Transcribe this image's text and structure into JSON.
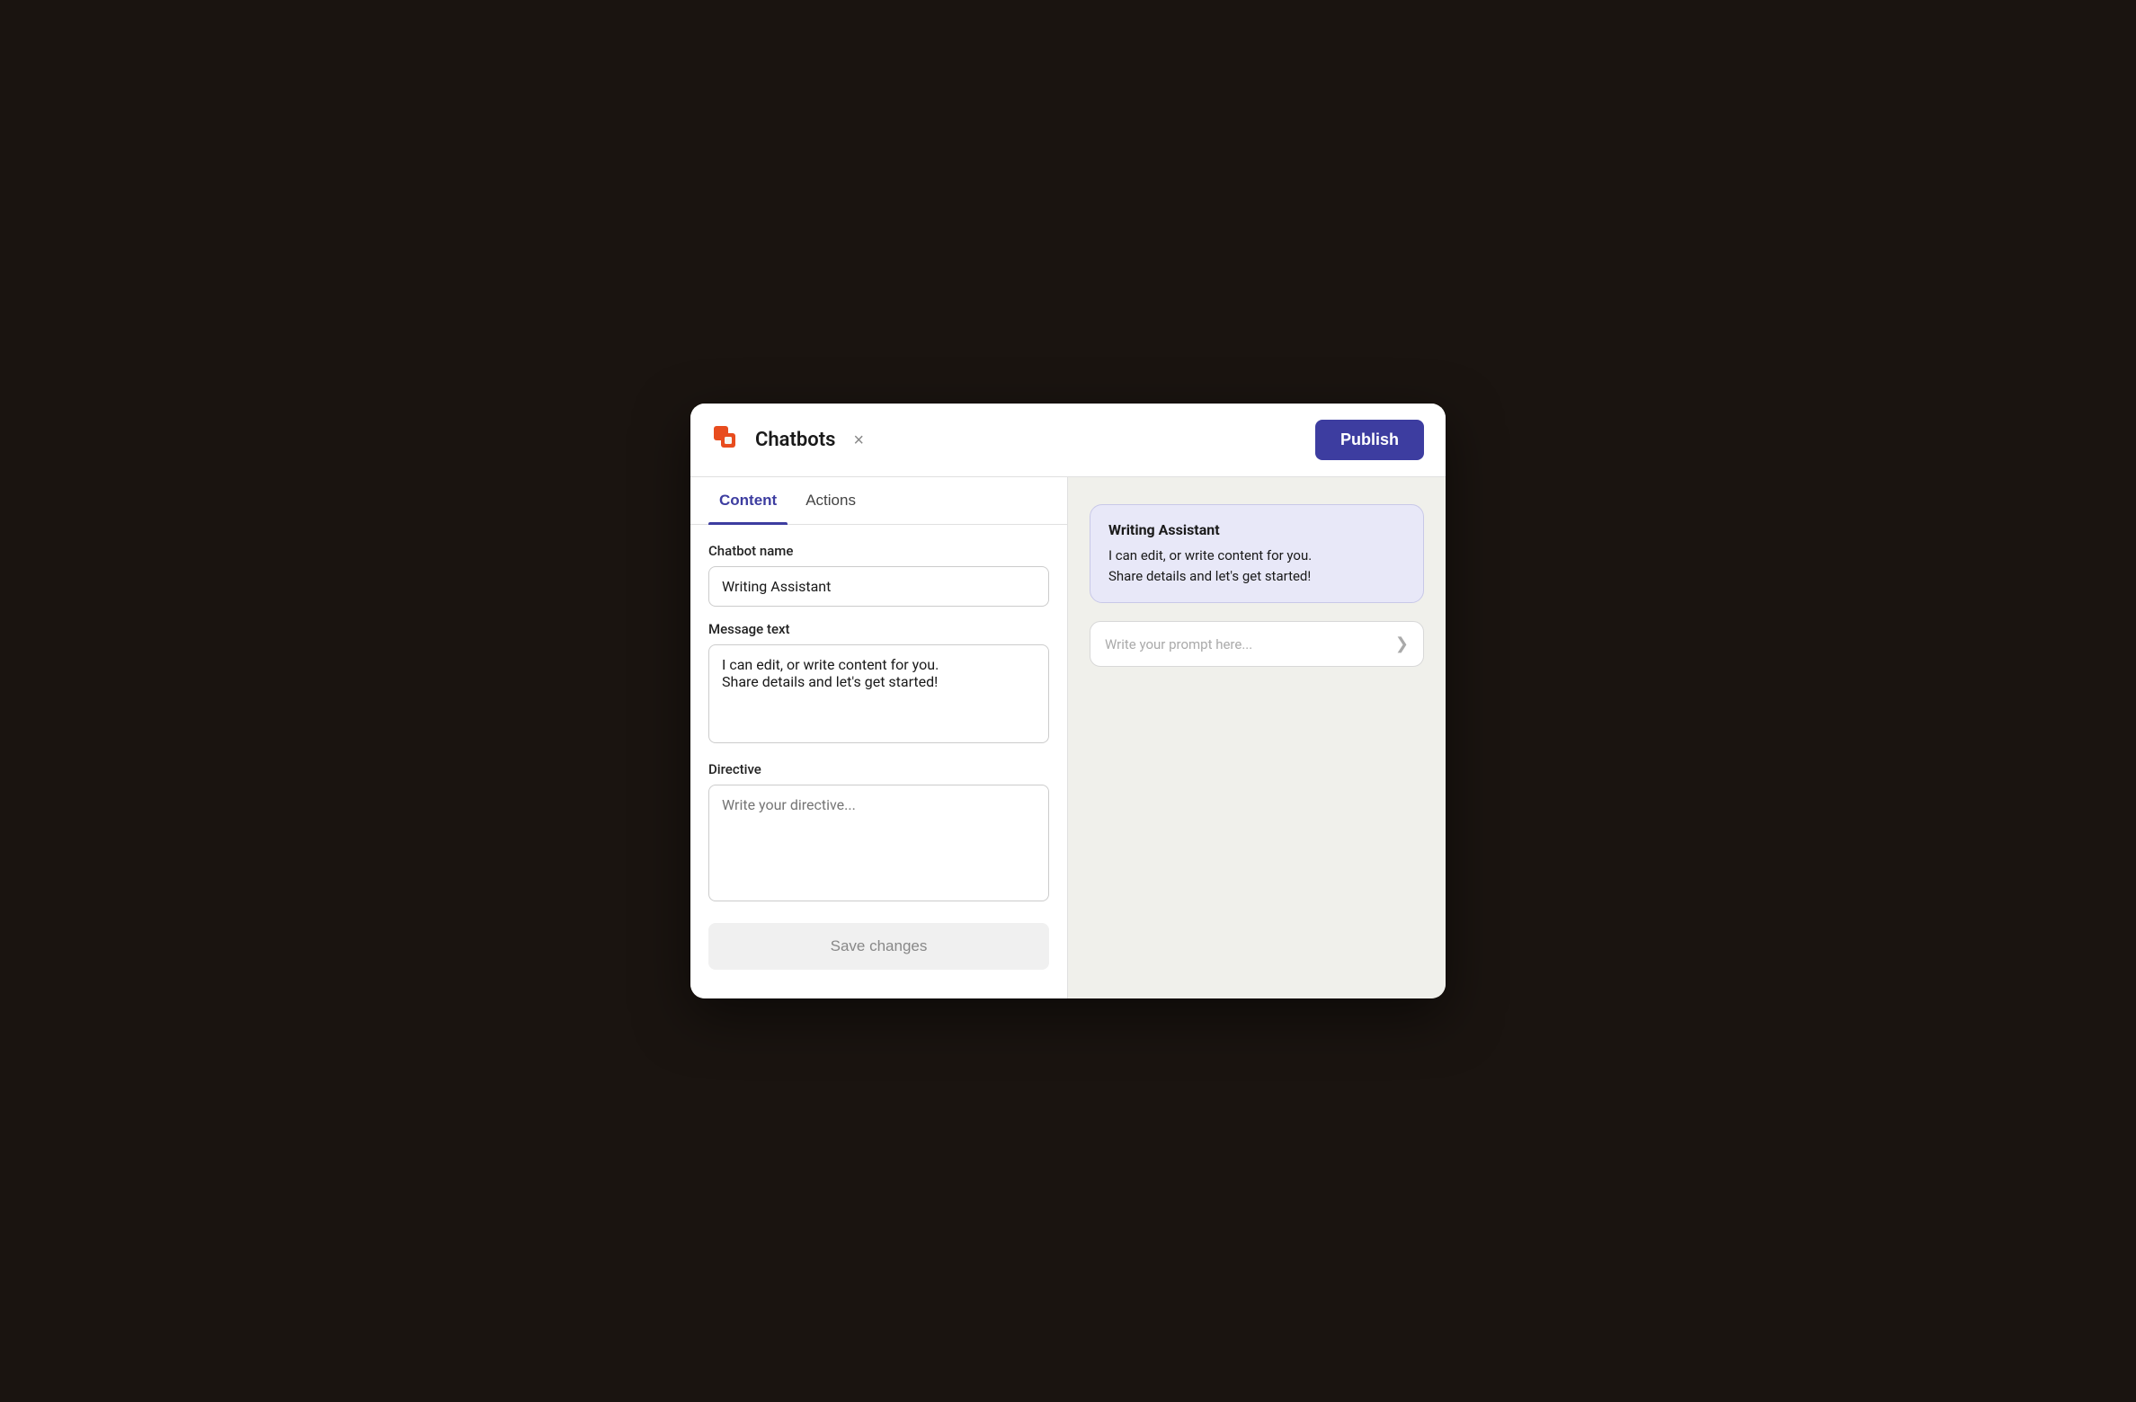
{
  "header": {
    "app_name": "Chatbots",
    "close_label": "×",
    "publish_label": "Publish"
  },
  "tabs": {
    "content_label": "Content",
    "actions_label": "Actions",
    "active": "content"
  },
  "form": {
    "chatbot_name_label": "Chatbot name",
    "chatbot_name_value": "Writing Assistant",
    "message_text_label": "Message text",
    "message_text_value": "I can edit, or write content for you.\nShare details and let's get started!",
    "directive_label": "Directive",
    "directive_placeholder": "Write your directive...",
    "save_button_label": "Save changes"
  },
  "preview": {
    "bubble_name": "Writing Assistant",
    "bubble_text": "I can edit, or write content for you.\nShare details and let's get started!",
    "prompt_placeholder": "Write your prompt here..."
  },
  "colors": {
    "accent": "#3d3da0",
    "logo_orange": "#e84c1e"
  }
}
